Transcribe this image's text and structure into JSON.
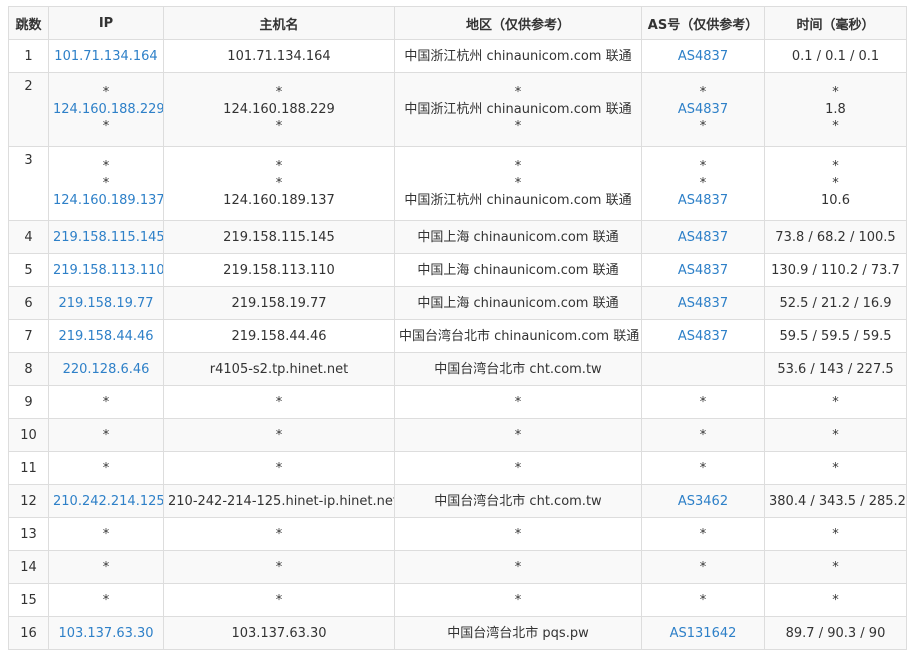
{
  "headers": [
    "跳数",
    "IP",
    "主机名",
    "地区（仅供参考）",
    "AS号（仅供参考）",
    "时间（毫秒）"
  ],
  "rows": [
    {
      "hop": "1",
      "ip": [
        "101.71.134.164"
      ],
      "host": [
        "101.71.134.164"
      ],
      "region": [
        "中国浙江杭州 chinaunicom.com 联通"
      ],
      "as": [
        "AS4837"
      ],
      "time": [
        "0.1 / 0.1 / 0.1"
      ]
    },
    {
      "hop": "2",
      "ip": [
        "*",
        "124.160.188.229",
        "*"
      ],
      "host": [
        "*",
        "124.160.188.229",
        "*"
      ],
      "region": [
        "*",
        "中国浙江杭州 chinaunicom.com 联通",
        "*"
      ],
      "as": [
        "*",
        "AS4837",
        "*"
      ],
      "time": [
        "*",
        "1.8",
        "*"
      ]
    },
    {
      "hop": "3",
      "ip": [
        "*",
        "*",
        "124.160.189.137"
      ],
      "host": [
        "*",
        "*",
        "124.160.189.137"
      ],
      "region": [
        "*",
        "*",
        "中国浙江杭州 chinaunicom.com 联通"
      ],
      "as": [
        "*",
        "*",
        "AS4837"
      ],
      "time": [
        "*",
        "*",
        "10.6"
      ]
    },
    {
      "hop": "4",
      "ip": [
        "219.158.115.145"
      ],
      "host": [
        "219.158.115.145"
      ],
      "region": [
        "中国上海 chinaunicom.com 联通"
      ],
      "as": [
        "AS4837"
      ],
      "time": [
        "73.8 / 68.2 / 100.5"
      ]
    },
    {
      "hop": "5",
      "ip": [
        "219.158.113.110"
      ],
      "host": [
        "219.158.113.110"
      ],
      "region": [
        "中国上海 chinaunicom.com 联通"
      ],
      "as": [
        "AS4837"
      ],
      "time": [
        "130.9 / 110.2 / 73.7"
      ]
    },
    {
      "hop": "6",
      "ip": [
        "219.158.19.77"
      ],
      "host": [
        "219.158.19.77"
      ],
      "region": [
        "中国上海 chinaunicom.com 联通"
      ],
      "as": [
        "AS4837"
      ],
      "time": [
        "52.5 / 21.2 / 16.9"
      ]
    },
    {
      "hop": "7",
      "ip": [
        "219.158.44.46"
      ],
      "host": [
        "219.158.44.46"
      ],
      "region": [
        "中国台湾台北市 chinaunicom.com 联通"
      ],
      "as": [
        "AS4837"
      ],
      "time": [
        "59.5 / 59.5 / 59.5"
      ]
    },
    {
      "hop": "8",
      "ip": [
        "220.128.6.46"
      ],
      "host": [
        "r4105-s2.tp.hinet.net"
      ],
      "region": [
        "中国台湾台北市 cht.com.tw"
      ],
      "as": [
        ""
      ],
      "time": [
        "53.6 / 143 / 227.5"
      ]
    },
    {
      "hop": "9",
      "ip": [
        "*"
      ],
      "host": [
        "*"
      ],
      "region": [
        "*"
      ],
      "as": [
        "*"
      ],
      "time": [
        "*"
      ]
    },
    {
      "hop": "10",
      "ip": [
        "*"
      ],
      "host": [
        "*"
      ],
      "region": [
        "*"
      ],
      "as": [
        "*"
      ],
      "time": [
        "*"
      ]
    },
    {
      "hop": "11",
      "ip": [
        "*"
      ],
      "host": [
        "*"
      ],
      "region": [
        "*"
      ],
      "as": [
        "*"
      ],
      "time": [
        "*"
      ]
    },
    {
      "hop": "12",
      "ip": [
        "210.242.214.125"
      ],
      "host": [
        "210-242-214-125.hinet-ip.hinet.net"
      ],
      "region": [
        "中国台湾台北市 cht.com.tw"
      ],
      "as": [
        "AS3462"
      ],
      "time": [
        "380.4 / 343.5 / 285.2"
      ]
    },
    {
      "hop": "13",
      "ip": [
        "*"
      ],
      "host": [
        "*"
      ],
      "region": [
        "*"
      ],
      "as": [
        "*"
      ],
      "time": [
        "*"
      ]
    },
    {
      "hop": "14",
      "ip": [
        "*"
      ],
      "host": [
        "*"
      ],
      "region": [
        "*"
      ],
      "as": [
        "*"
      ],
      "time": [
        "*"
      ]
    },
    {
      "hop": "15",
      "ip": [
        "*"
      ],
      "host": [
        "*"
      ],
      "region": [
        "*"
      ],
      "as": [
        "*"
      ],
      "time": [
        "*"
      ]
    },
    {
      "hop": "16",
      "ip": [
        "103.137.63.30"
      ],
      "host": [
        "103.137.63.30"
      ],
      "region": [
        "中国台湾台北市 pqs.pw"
      ],
      "as": [
        "AS131642"
      ],
      "time": [
        "89.7 / 90.3 / 90"
      ]
    }
  ],
  "colors": {
    "link": "#2e80c8",
    "border": "#dddddd",
    "header_bg": "#f8f8f8",
    "stripe_bg": "#f9f9f9",
    "text": "#333333"
  }
}
